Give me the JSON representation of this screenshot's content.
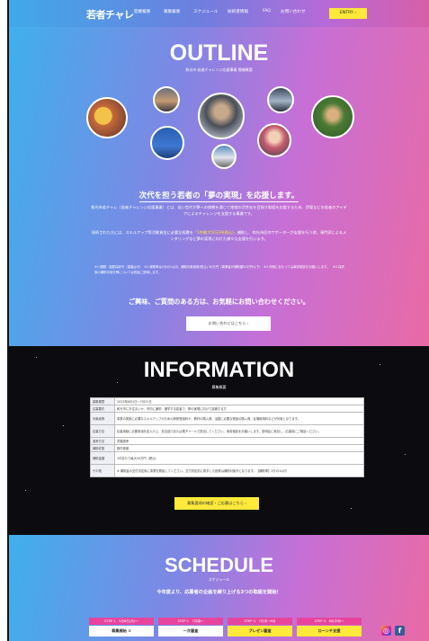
{
  "nav": {
    "logo": "若者チャレ",
    "items": [
      "開催概要",
      "募集概要",
      "スケジュール",
      "採択者情報",
      "FAQ",
      "お問い合わせ"
    ],
    "cta": "ENTRY ›"
  },
  "outline": {
    "title": "OUTLINE",
    "subtitle": "和光市 若者チャレンジ応援事業 開催概要",
    "lead": "次代を担う若者の「夢の実現」を応援します。",
    "para1": "和光市若チャレ（若者チャレンジ応援事業）とは、若い世代が夢への挑戦を通じて地域の活性化を目指す取組を応援するため、伊東などの若者のアイデアによるチャレンジを支援する事業です。",
    "para2_pre": "採択された方には、スキルアップ等活動資金に必要な経費を",
    "para2_hl": "「1件最大50万円(税込)」",
    "para2_post": "補助し、和光市民のサポーターが支援を行う他、専門家によるメンタリングなど夢の実現に向けた様々な支援を行います。",
    "notes": "※1 期間・複数採択可（重複は可）　※2 補助率は2分の1以内、補助対象経費(税込) 50万円（事業者が補助額50万円以下）　※3 申請にあたっては事前相談をお願いします。　※4 採択後の補助手続き等については別途ご説明します。",
    "contact": "ご興味、ご質問のある方は、お気軽にお問い合わせください。",
    "contact_button": "お問い合わせはこちら ›"
  },
  "information": {
    "title": "INFORMATION",
    "subtitle": "募集概要",
    "rows": [
      {
        "k": "募集期間",
        "v": "2023年6月1日〜7月31日"
      },
      {
        "k": "応募要件",
        "v": "和光市にお住まいか、市内に通勤・通学する若者で、夢の実現に向けて挑戦する方"
      },
      {
        "k": "対象経費",
        "v": "事業の実施に必要なスキルアップのための研修受講料や、教材の購入費、活動に必要な物品の購入費、会場使用料などが対象となります。"
      },
      {
        "k": "応募方法",
        "v": "応募用紙に必要事項を記入の上、担当窓口または電子メールで提出してください。事前相談をお願いします。説明会に参加し、応募前にご相談ください。"
      },
      {
        "k": "選考方法",
        "v": "書類選考"
      },
      {
        "k": "補助件数",
        "v": "数件程度"
      },
      {
        "k": "補助金額",
        "v": "1件あたり最大50万円（税込）"
      },
      {
        "k": "その他",
        "v": "※ 補助金の交付決定後に事業を開始してください。交付決定前に着手した経費は補助対象外となります。【補助率】2分の1以内"
      }
    ],
    "button": "募集要項の確認・ご応募はこちら ›"
  },
  "schedule": {
    "title": "SCHEDULE",
    "subtitle": "スケジュール",
    "lead": "今年度より、応募者の企画を練り上げる3つの取組を開始！",
    "steps": [
      {
        "top": "STEP 1　5月8日(月)〜",
        "bottom": "募集開始 ①"
      },
      {
        "top": "STEP 2　7月頃〜",
        "bottom": "一次審査"
      },
      {
        "top": "STEP 3　7月末〜8月",
        "bottom": "プレゼン審査"
      },
      {
        "top": "STEP 4　8月中旬〜",
        "bottom": "ローンチ支援"
      }
    ]
  },
  "colors": {
    "accent": "#ffe93a",
    "pink": "#e7449e",
    "blue": "#3fa9e8"
  },
  "icons": [
    "instagram-icon",
    "facebook-icon"
  ]
}
